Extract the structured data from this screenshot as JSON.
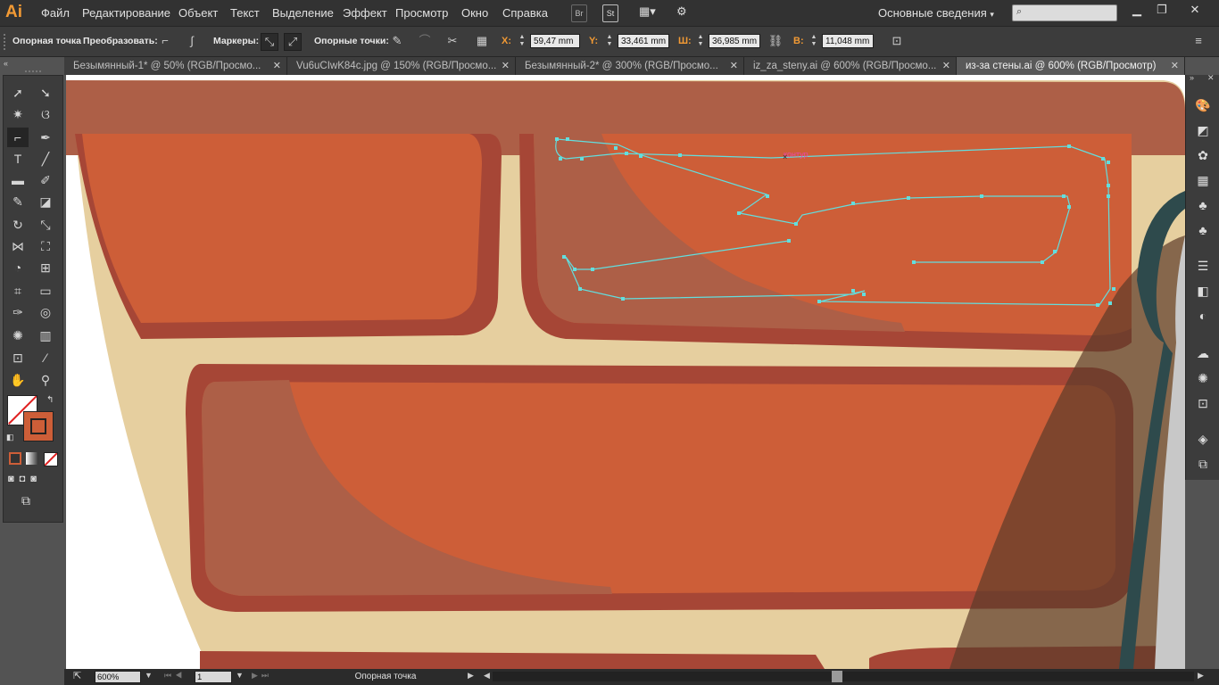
{
  "app": {
    "logo": "Ai"
  },
  "menu": [
    "Файл",
    "Редактирование",
    "Объект",
    "Текст",
    "Выделение",
    "Эффект",
    "Просмотр",
    "Окно",
    "Справка"
  ],
  "menu_buttons": {
    "bridge": "Br",
    "stock": "St"
  },
  "workspace": {
    "label": "Основные сведения"
  },
  "controls": {
    "anchor_label": "Опорная точка",
    "convert_label": "Преобразовать:",
    "handles_label": "Маркеры:",
    "anchors_label": "Опорные точки:",
    "x_label": "X:",
    "x_value": "59,47 mm",
    "y_label": "Y:",
    "y_value": "33,461 mm",
    "w_label": "Ш:",
    "w_value": "36,985 mm",
    "h_label": "В:",
    "h_value": "11,048 mm"
  },
  "tabs": [
    {
      "label": "Безымянный-1* @ 50% (RGB/Просмо...",
      "active": false
    },
    {
      "label": "Vu6uCIwK84c.jpg @ 150% (RGB/Просмо...",
      "active": false
    },
    {
      "label": "Безымянный-2* @ 300% (RGB/Просмо...",
      "active": false
    },
    {
      "label": "iz_za_steny.ai @ 600% (RGB/Просмо...",
      "active": false
    },
    {
      "label": "из-за стены.ai @ 600% (RGB/Просмотр)",
      "active": true
    }
  ],
  "canvas": {
    "path_hint": "контур"
  },
  "status": {
    "zoom": "600%",
    "page": "1",
    "tool_text": "Опорная точка"
  },
  "colors": {
    "brick": "#cd5e38",
    "brick_dark": "#a64636",
    "wall_top": "#ad5f47",
    "mortar": "#e6cf9f",
    "path": "#62dede",
    "accent": "#f29a34"
  },
  "tools": [
    "selection-tool",
    "direct-selection-tool",
    "magic-wand-tool",
    "lasso-tool",
    "anchor-point-tool",
    "pen-tool",
    "type-tool",
    "line-tool",
    "rectangle-tool",
    "paintbrush-tool",
    "blob-brush-tool",
    "eraser-tool",
    "rotate-tool",
    "scale-tool",
    "width-tool",
    "free-transform-tool",
    "shape-builder-tool",
    "perspective-grid-tool",
    "mesh-tool",
    "gradient-tool",
    "eyedropper-tool",
    "blend-tool",
    "symbol-sprayer-tool",
    "column-graph-tool",
    "artboard-tool",
    "slice-tool",
    "hand-tool",
    "zoom-tool"
  ],
  "right_panels": [
    "color-icon",
    "color-guide-icon",
    "swatches-icon",
    "brushes-icon",
    "symbols-icon",
    "graphic-styles-icon",
    "stroke-icon",
    "gradient-icon",
    "transparency-icon",
    "appearance-icon",
    "libraries-icon",
    "layers-icon",
    "artboards-icon"
  ]
}
